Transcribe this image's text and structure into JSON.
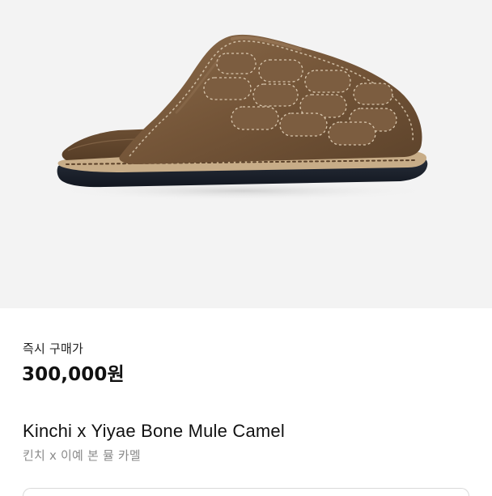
{
  "product": {
    "image_description": "",
    "buy_now_label": "즉시 구매가",
    "price": "300,000원",
    "name_en": "Kinchi x Yiyae Bone Mule Camel",
    "name_ko": "킨치 x 이예 본 뮬 카멜"
  },
  "colors": {
    "image_background": "#f3f3f3",
    "suede": "#7a5b3e",
    "sole": "#1f2530",
    "price_text": "#111111",
    "secondary_text": "#8a8a8a"
  }
}
